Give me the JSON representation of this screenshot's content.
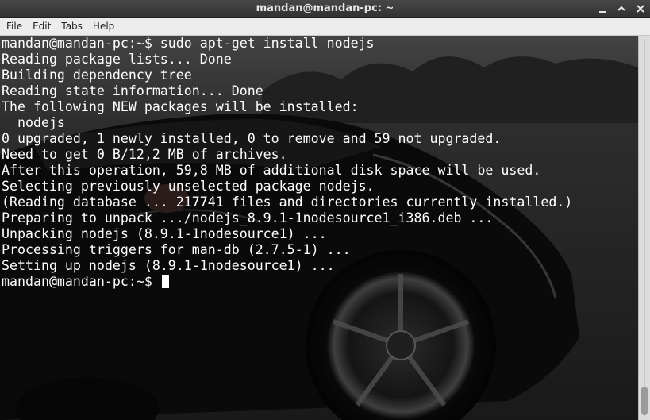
{
  "window": {
    "title": "mandan@mandan-pc: ~"
  },
  "menu": {
    "items": [
      "File",
      "Edit",
      "Tabs",
      "Help"
    ]
  },
  "terminal": {
    "prompt": "mandan@mandan-pc:~$",
    "lines": [
      "mandan@mandan-pc:~$ sudo apt-get install nodejs",
      "Reading package lists... Done",
      "Building dependency tree",
      "Reading state information... Done",
      "The following NEW packages will be installed:",
      "  nodejs",
      "0 upgraded, 1 newly installed, 0 to remove and 59 not upgraded.",
      "Need to get 0 B/12,2 MB of archives.",
      "After this operation, 59,8 MB of additional disk space will be used.",
      "Selecting previously unselected package nodejs.",
      "(Reading database ... 217741 files and directories currently installed.)",
      "Preparing to unpack .../nodejs_8.9.1-1nodesource1_i386.deb ...",
      "Unpacking nodejs (8.9.1-1nodesource1) ...",
      "Processing triggers for man-db (2.7.5-1) ...",
      "Setting up nodejs (8.9.1-1nodesource1) ..."
    ]
  },
  "scrollbar": {
    "position_fraction": 1.0
  },
  "icons": {
    "minimize": "minimize-icon",
    "maximize": "maximize-icon",
    "close": "close-icon"
  },
  "colors": {
    "titlebar": "#3c3c3c",
    "menubar": "#ececec",
    "terminal_text": "#ffffff"
  }
}
